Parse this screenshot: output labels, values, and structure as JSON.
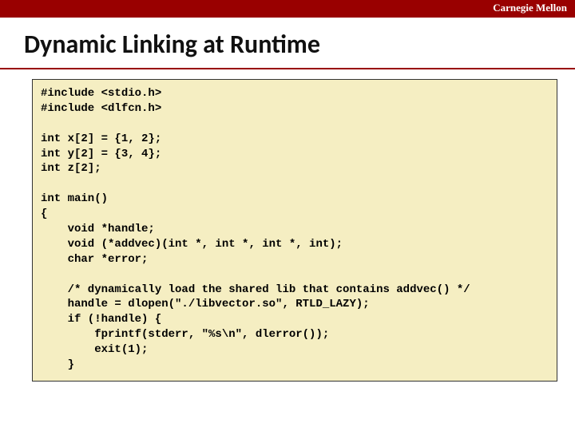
{
  "brand": "Carnegie Mellon",
  "title": "Dynamic Linking at Runtime",
  "code": "#include <stdio.h>\n#include <dlfcn.h>\n\nint x[2] = {1, 2};\nint y[2] = {3, 4};\nint z[2];\n\nint main()\n{\n    void *handle;\n    void (*addvec)(int *, int *, int *, int);\n    char *error;\n\n    /* dynamically load the shared lib that contains addvec() */\n    handle = dlopen(\"./libvector.so\", RTLD_LAZY);\n    if (!handle) {\n        fprintf(stderr, \"%s\\n\", dlerror());\n        exit(1);\n    }"
}
